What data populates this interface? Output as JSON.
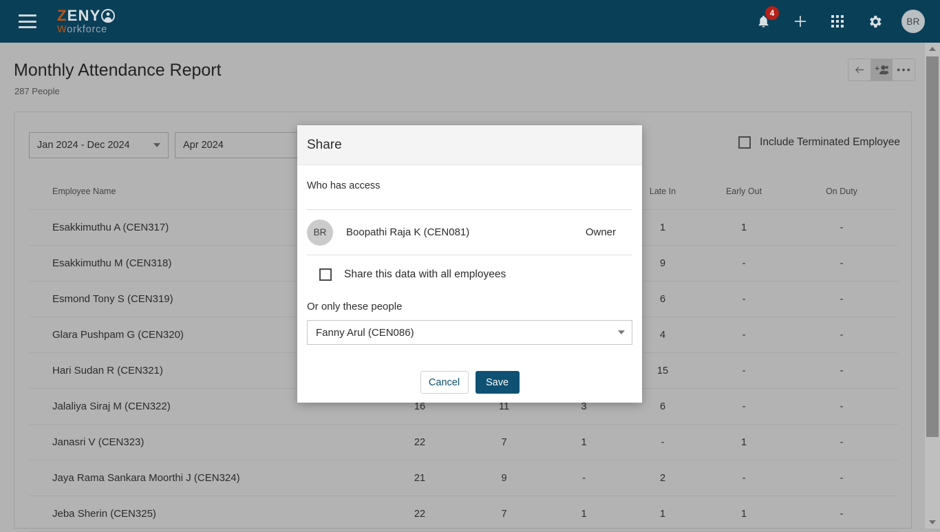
{
  "topbar": {
    "menu_icon": "hamburger-menu-icon",
    "logo": {
      "part1": "Z",
      "part2": "ENY",
      "part3": "W",
      "part4": "orkforce"
    },
    "notifications": {
      "icon": "bell-icon",
      "count": "4"
    },
    "add": {
      "icon": "plus-icon"
    },
    "apps": {
      "icon": "apps-grid-icon"
    },
    "settings": {
      "icon": "gear-icon"
    },
    "avatar": {
      "initials": "BR"
    }
  },
  "page": {
    "title": "Monthly Attendance Report",
    "subtitle": "287 People",
    "actions": {
      "back": "back-arrow-icon",
      "share": "add-person-icon",
      "more": "more-options-icon"
    }
  },
  "filters": {
    "date_range": "Jan 2024 - Dec 2024",
    "month": "Apr 2024",
    "include_terminated_label": "Include Terminated Employee",
    "include_terminated_checked": false
  },
  "table": {
    "headers": [
      "Employee Name",
      "",
      "",
      "",
      "Late In",
      "Early Out",
      "On Duty"
    ],
    "rows": [
      {
        "name": "Esakkimuthu A (CEN317)",
        "c1": "",
        "c2": "",
        "c3": "",
        "late_in": "1",
        "early_out": "1",
        "on_duty": "-"
      },
      {
        "name": "Esakkimuthu M (CEN318)",
        "c1": "",
        "c2": "",
        "c3": "",
        "late_in": "9",
        "early_out": "-",
        "on_duty": "-"
      },
      {
        "name": "Esmond Tony S (CEN319)",
        "c1": "",
        "c2": "",
        "c3": "",
        "late_in": "6",
        "early_out": "-",
        "on_duty": "-"
      },
      {
        "name": "Glara Pushpam G (CEN320)",
        "c1": "",
        "c2": "",
        "c3": "",
        "late_in": "4",
        "early_out": "-",
        "on_duty": "-"
      },
      {
        "name": "Hari Sudan R (CEN321)",
        "c1": "",
        "c2": "",
        "c3": "",
        "late_in": "15",
        "early_out": "-",
        "on_duty": "-"
      },
      {
        "name": "Jalaliya Siraj M (CEN322)",
        "c1": "16",
        "c2": "11",
        "c3": "3",
        "late_in": "6",
        "early_out": "-",
        "on_duty": "-"
      },
      {
        "name": "Janasri V (CEN323)",
        "c1": "22",
        "c2": "7",
        "c3": "1",
        "late_in": "-",
        "early_out": "1",
        "on_duty": "-"
      },
      {
        "name": "Jaya Rama Sankara Moorthi J (CEN324)",
        "c1": "21",
        "c2": "9",
        "c3": "-",
        "late_in": "2",
        "early_out": "-",
        "on_duty": "-"
      },
      {
        "name": "Jeba Sherin (CEN325)",
        "c1": "22",
        "c2": "7",
        "c3": "1",
        "late_in": "1",
        "early_out": "1",
        "on_duty": "-"
      }
    ]
  },
  "dialog": {
    "title": "Share",
    "who_has_access_label": "Who has access",
    "owner": {
      "initials": "BR",
      "name": "Boopathi Raja K (CEN081)",
      "role": "Owner"
    },
    "share_all_label": "Share this data with all employees",
    "share_all_checked": false,
    "only_these_people_label": "Or only these people",
    "selected_person": "Fanny Arul (CEN086)",
    "cancel_label": "Cancel",
    "save_label": "Save"
  },
  "colors": {
    "topbar_bg": "#0a3f58",
    "accent_orange": "#c25511",
    "save_button": "#0e5173",
    "badge_red": "#b52018",
    "page_bg": "#b3b3b3"
  }
}
